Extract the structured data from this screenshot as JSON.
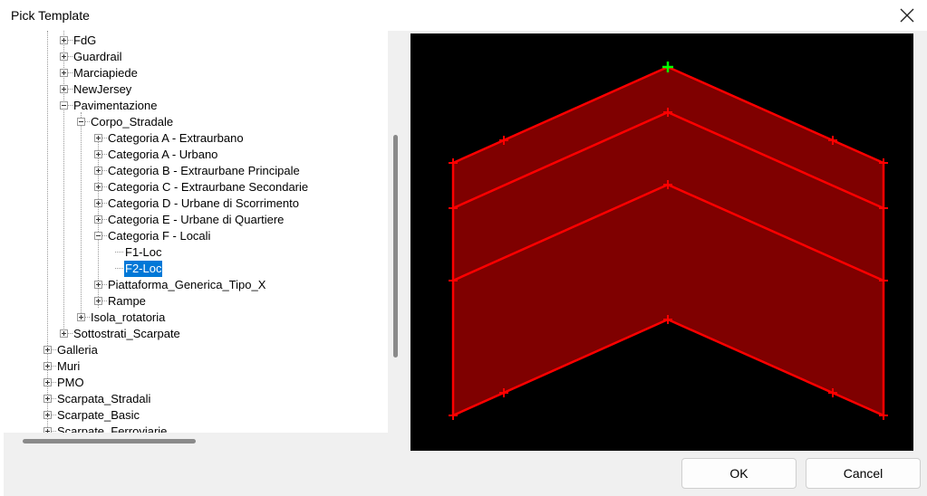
{
  "dialog": {
    "title": "Pick Template"
  },
  "tree": {
    "items": [
      {
        "label": "FdG",
        "expander": "plus"
      },
      {
        "label": "Guardrail",
        "expander": "plus"
      },
      {
        "label": "Marciapiede",
        "expander": "plus"
      },
      {
        "label": "NewJersey",
        "expander": "plus"
      },
      {
        "label": "Pavimentazione",
        "expander": "minus"
      },
      {
        "label": "Corpo_Stradale",
        "expander": "minus"
      },
      {
        "label": "Categoria A - Extraurbano",
        "expander": "plus"
      },
      {
        "label": "Categoria A - Urbano",
        "expander": "plus"
      },
      {
        "label": "Categoria B - Extraurbane Principale",
        "expander": "plus"
      },
      {
        "label": "Categoria C - Extraurbane Secondarie",
        "expander": "plus"
      },
      {
        "label": "Categoria D - Urbane di Scorrimento",
        "expander": "plus"
      },
      {
        "label": "Categoria E - Urbane di Quartiere",
        "expander": "plus"
      },
      {
        "label": "Categoria F - Locali",
        "expander": "minus"
      },
      {
        "label": "F1-Loc",
        "expander": "none"
      },
      {
        "label": "F2-Loc",
        "expander": "none",
        "selected": true
      },
      {
        "label": "Piattaforma_Generica_Tipo_X",
        "expander": "plus"
      },
      {
        "label": "Rampe",
        "expander": "plus"
      },
      {
        "label": "Isola_rotatoria",
        "expander": "plus"
      },
      {
        "label": "Sottostrati_Scarpate",
        "expander": "plus"
      },
      {
        "label": "Galleria",
        "expander": "plus"
      },
      {
        "label": "Muri",
        "expander": "plus"
      },
      {
        "label": "PMO",
        "expander": "plus"
      },
      {
        "label": "Scarpata_Stradali",
        "expander": "plus"
      },
      {
        "label": "Scarpate_Basic",
        "expander": "plus"
      },
      {
        "label": "Scarpate_Ferroviarie",
        "expander": "plus"
      }
    ]
  },
  "preview": {
    "background": "#000000",
    "fill": "#7f0000",
    "stroke": "#ff0000",
    "origin_marker": "#00ff00"
  },
  "buttons": {
    "ok": "OK",
    "cancel": "Cancel"
  }
}
